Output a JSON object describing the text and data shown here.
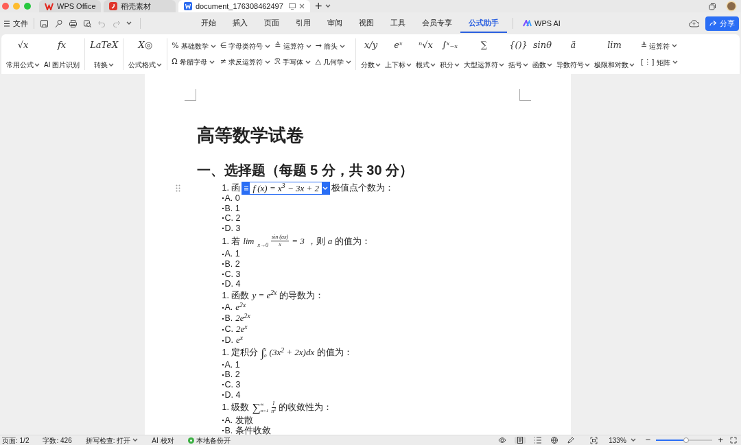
{
  "window_tabs": [
    {
      "kind": "wps",
      "label": "WPS Office",
      "selected": false
    },
    {
      "kind": "docer",
      "label": "稻壳素材",
      "selected": false
    },
    {
      "kind": "doc",
      "label": "document_176308462497",
      "selected": true
    }
  ],
  "new_tab": "+",
  "menu": {
    "file": "文件",
    "tabs": [
      {
        "label": "开始",
        "selected": false
      },
      {
        "label": "插入",
        "selected": false
      },
      {
        "label": "页面",
        "selected": false
      },
      {
        "label": "引用",
        "selected": false
      },
      {
        "label": "审阅",
        "selected": false
      },
      {
        "label": "视图",
        "selected": false
      },
      {
        "label": "工具",
        "selected": false
      },
      {
        "label": "会员专享",
        "selected": false
      },
      {
        "label": "公式助手",
        "selected": true
      }
    ],
    "ai_tab": "WPS AI",
    "share": "分享"
  },
  "ribbon": [
    {
      "kind": "large",
      "items": [
        {
          "icon": "√x",
          "label": "常用公式",
          "dropdown": true
        },
        {
          "icon": "fx",
          "label": "AI 图片识别",
          "dropdown": false
        }
      ]
    },
    {
      "kind": "large",
      "items": [
        {
          "icon": "LaTeX",
          "label": "转换",
          "dropdown": true
        }
      ]
    },
    {
      "kind": "large",
      "items": [
        {
          "icon": "X◎",
          "label": "公式格式",
          "dropdown": true
        }
      ]
    },
    {
      "kind": "small",
      "items": [
        {
          "icon": "%",
          "label": "基础数学"
        },
        {
          "icon": "∈",
          "label": "字母类符号"
        },
        {
          "icon": "≜",
          "label": "运算符"
        },
        {
          "icon": "→",
          "label": "箭头"
        },
        {
          "icon": "Ω",
          "label": "希腊字母"
        },
        {
          "icon": "≠",
          "label": "求反运算符"
        },
        {
          "icon": "ℛ",
          "label": "手写体"
        },
        {
          "icon": "△",
          "label": "几何学"
        }
      ]
    },
    {
      "kind": "large",
      "items": [
        {
          "icon": "x/y",
          "label": "分数",
          "dropdown": true
        },
        {
          "icon": "eˣ",
          "label": "上下标",
          "dropdown": true
        },
        {
          "icon": "ⁿ√x",
          "label": "根式",
          "dropdown": true
        },
        {
          "icon": "∫ˣ₋ₓ",
          "label": "积分",
          "dropdown": true
        },
        {
          "icon": "∑",
          "label": "大型运算符",
          "dropdown": true
        },
        {
          "icon": "{()}",
          "label": "括号",
          "dropdown": true
        },
        {
          "icon": "sinθ",
          "label": "函数",
          "dropdown": true
        },
        {
          "icon": "ä",
          "label": "导数符号",
          "dropdown": true
        },
        {
          "icon": "lim",
          "label": "极限和对数",
          "dropdown": true
        }
      ]
    },
    {
      "kind": "column",
      "items": [
        {
          "icon": "≜",
          "label": "运算符"
        },
        {
          "icon": "[⋮]",
          "label": "矩阵"
        }
      ]
    }
  ],
  "document": {
    "title": "高等数学试卷",
    "heading": "一、选择题（每题 5 分，共 30 分）",
    "questions": [
      {
        "parts": [
          {
            "kind": "text",
            "text": "1. 函"
          },
          {
            "kind": "math",
            "text": "f (x) = x$^{3}$ − 3x + 2",
            "editing": true
          },
          {
            "kind": "text",
            "text": "极值点个数为："
          }
        ],
        "options": [
          {
            "text": "A. 0"
          },
          {
            "text": "B. 1"
          },
          {
            "text": "C. 2"
          },
          {
            "text": "D. 3"
          }
        ]
      },
      {
        "parts": [
          {
            "kind": "text",
            "text": "1. 若"
          },
          {
            "kind": "lim",
            "text": "lim",
            "sub": "x→0"
          },
          {
            "kind": "frac",
            "num": "sin (ax)",
            "den": "x"
          },
          {
            "kind": "math",
            "text": "= 3"
          },
          {
            "kind": "text",
            "text": "，则"
          },
          {
            "kind": "math",
            "text": "a"
          },
          {
            "kind": "text",
            "text": "的值为："
          }
        ],
        "options": [
          {
            "text": "A. 1"
          },
          {
            "text": "B. 2"
          },
          {
            "text": "C. 3"
          },
          {
            "text": "D. 4"
          }
        ]
      },
      {
        "parts": [
          {
            "kind": "text",
            "text": "1. 函数"
          },
          {
            "kind": "math",
            "text": "y = e$^{2x}$"
          },
          {
            "kind": "text",
            "text": "的导数为："
          }
        ],
        "options": [
          {
            "text": "A.",
            "math": "e$^{2x}$"
          },
          {
            "text": "B.",
            "math": "2e$^{2x}$"
          },
          {
            "text": "C.",
            "math": "2e$^{x}$"
          },
          {
            "text": "D.",
            "math": "e$^{x}$"
          }
        ]
      },
      {
        "parts": [
          {
            "kind": "text",
            "text": "1. 定积分"
          },
          {
            "kind": "int",
            "sign": "∫",
            "lower": "0",
            "upper": "1"
          },
          {
            "kind": "math",
            "text": "(3x$^{2}$ + 2x)dx"
          },
          {
            "kind": "text",
            "text": "的值为："
          }
        ],
        "options": [
          {
            "text": "A. 1"
          },
          {
            "text": "B. 2"
          },
          {
            "text": "C. 3"
          },
          {
            "text": "D. 4"
          }
        ]
      },
      {
        "parts": [
          {
            "kind": "text",
            "text": "1. 级数"
          },
          {
            "kind": "sum",
            "sign": "∑",
            "lower": "n=1",
            "upper": "∞"
          },
          {
            "kind": "frac",
            "num": "1",
            "den": "n$^{2}$"
          },
          {
            "kind": "text",
            "text": "的收敛性为："
          }
        ],
        "options": [
          {
            "text": "A. 发散"
          },
          {
            "text": "B. 条件收敛"
          }
        ]
      }
    ]
  },
  "status_bar": {
    "items": [
      {
        "kind": "text",
        "label": "页面: 1/2"
      },
      {
        "kind": "text",
        "label": "字数: 426"
      },
      {
        "kind": "dropdown",
        "label": "拼写检查: 打开"
      },
      {
        "kind": "text",
        "label": "AI 校对"
      },
      {
        "kind": "dot",
        "label": "本地备份开",
        "color": "#3cb043"
      }
    ],
    "zoom": "133%",
    "zoom_slider": {
      "level": 0.53
    },
    "minus": "−",
    "plus": "+"
  }
}
